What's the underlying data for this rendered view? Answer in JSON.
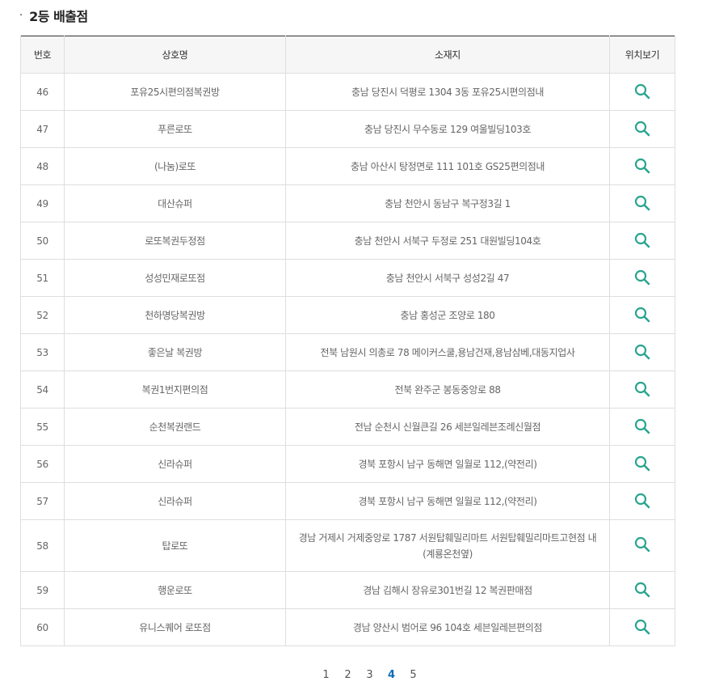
{
  "section": {
    "bullet": "·",
    "title": "2등 배출점"
  },
  "table": {
    "headers": {
      "no": "번호",
      "name": "상호명",
      "address": "소재지",
      "map": "위치보기"
    },
    "rows": [
      {
        "no": "46",
        "name": "포유25시편의점복권방",
        "address": "충남 당진시 덕평로 1304 3동 포유25시편의점내"
      },
      {
        "no": "47",
        "name": "푸른로또",
        "address": "충남 당진시 무수동로 129 여울빌딩103호"
      },
      {
        "no": "48",
        "name": "(나눔)로또",
        "address": "충남 아산시 탕정면로 111 101호 GS25편의점내"
      },
      {
        "no": "49",
        "name": "대산슈퍼",
        "address": "충남 천안시 동남구 복구정3길 1"
      },
      {
        "no": "50",
        "name": "로또복권두정점",
        "address": "충남 천안시 서북구 두정로 251 대원빌딩104호"
      },
      {
        "no": "51",
        "name": "성성민재로또점",
        "address": "충남 천안시 서북구 성성2길 47"
      },
      {
        "no": "52",
        "name": "천하명당복권방",
        "address": "충남 홍성군 조양로 180"
      },
      {
        "no": "53",
        "name": "좋은날 복권방",
        "address": "전북 남원시 의총로 78 메이커스쿨,용남건재,용남삼베,대동지업사"
      },
      {
        "no": "54",
        "name": "복권1번지편의점",
        "address": "전북 완주군 봉동중앙로 88"
      },
      {
        "no": "55",
        "name": "순천복권랜드",
        "address": "전남 순천시 신월큰길 26 세븐일레븐조례신월점"
      },
      {
        "no": "56",
        "name": "신라슈퍼",
        "address": "경북 포항시 남구 동해면 일월로 112,(약전리)"
      },
      {
        "no": "57",
        "name": "신라슈퍼",
        "address": "경북 포항시 남구 동해면 일월로 112,(약전리)"
      },
      {
        "no": "58",
        "name": "탑로또",
        "address": "경남 거제시 거제중앙로 1787 서원탑훼밀리마트 서원탑훼밀리마트고현점 내 (계룡온천옆)"
      },
      {
        "no": "59",
        "name": "행운로또",
        "address": "경남 김해시 장유로301번길 12 복권판매점"
      },
      {
        "no": "60",
        "name": "유니스퀘어 로또점",
        "address": "경남 양산시 범어로 96 104호 세븐일레븐편의점"
      }
    ],
    "map_icon": "search-icon",
    "icon_color": "#2aa58f"
  },
  "pagination": {
    "pages": [
      "1",
      "2",
      "3",
      "4",
      "5"
    ],
    "current": "4",
    "active_color": "#0a6bb8"
  }
}
